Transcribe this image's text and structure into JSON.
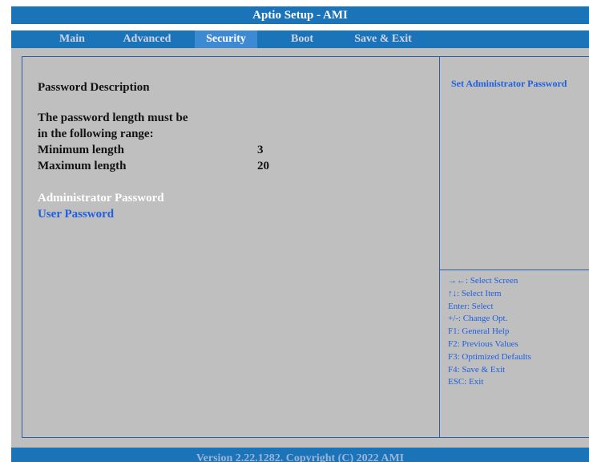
{
  "window": {
    "title": "Aptio Setup - AMI"
  },
  "menu": {
    "tabs": [
      {
        "label": "Main"
      },
      {
        "label": "Advanced"
      },
      {
        "label": "Security"
      },
      {
        "label": "Boot"
      },
      {
        "label": "Save & Exit"
      }
    ],
    "active": "Security"
  },
  "main": {
    "heading": "Password Description",
    "desc_line1": "The password length must be",
    "desc_line2": "in the following range:",
    "min_label": "Minimum length",
    "min_value": "3",
    "max_label": "Maximum length",
    "max_value": "20",
    "items": [
      {
        "label": "Administrator Password",
        "selected": true
      },
      {
        "label": "User Password",
        "selected": false
      }
    ]
  },
  "help": {
    "title": "Set Administrator Password",
    "keys": [
      "→←: Select Screen",
      "↑↓: Select Item",
      "Enter: Select",
      "+/-: Change Opt.",
      "F1: General Help",
      "F2: Previous Values",
      "F3: Optimized Defaults",
      "F4: Save & Exit",
      "ESC: Exit"
    ]
  },
  "footer": {
    "text": "Version 2.22.1282. Copyright (C) 2022 AMI"
  },
  "colors": {
    "bar_blue": "#1b74b8",
    "active_tab": "#3d8ad3",
    "panel_gray": "#bfbfbf",
    "highlight_text": "#1f5fe0",
    "selected_item_text": "#ffffff"
  }
}
